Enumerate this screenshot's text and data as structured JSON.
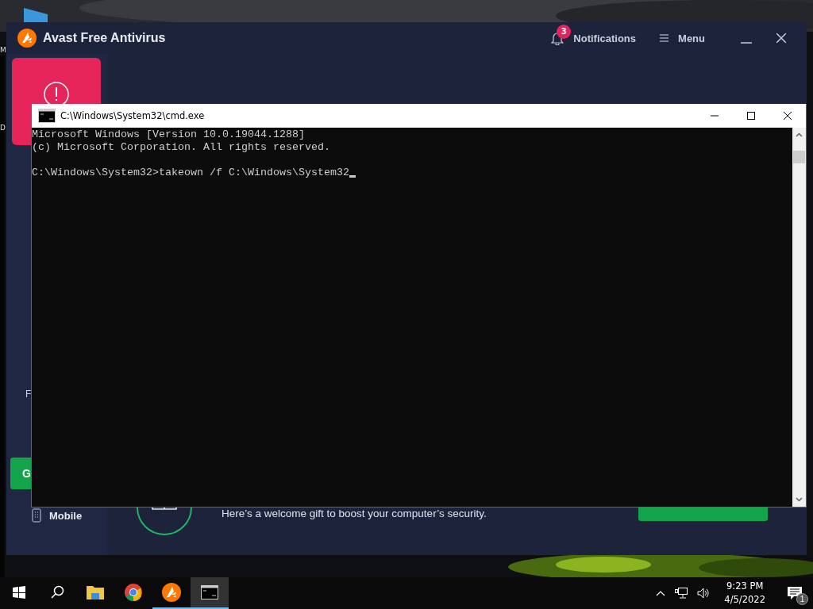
{
  "desktop": {
    "icon_labels": [
      "M",
      "D"
    ]
  },
  "avast": {
    "title": "Avast Free Antivirus",
    "notifications": {
      "label": "Notifications",
      "count": "3"
    },
    "menu": "Menu",
    "sidebar": {
      "item_fragment": "F",
      "button_fragment": "G",
      "mobile": "Mobile"
    },
    "promo_text": "Here’s a welcome gift to boost your computer’s security."
  },
  "cmd": {
    "title": "C:\\Windows\\System32\\cmd.exe",
    "paragraphs": [
      [
        "Microsoft Windows [Version 10.0.19044.1288]",
        "(c) Microsoft Corporation. All rights reserved."
      ],
      [
        "C:\\Windows\\System32>takeown /f C:\\Windows\\System32"
      ]
    ]
  },
  "taskbar": {
    "apps": [
      {
        "kind": "start",
        "running": false,
        "selected": false
      },
      {
        "kind": "search",
        "running": false,
        "selected": false
      },
      {
        "kind": "explorer",
        "running": false,
        "selected": false
      },
      {
        "kind": "chrome",
        "running": false,
        "selected": false
      },
      {
        "kind": "avast",
        "running": true,
        "selected": false
      },
      {
        "kind": "cmd",
        "running": true,
        "selected": true
      }
    ],
    "time": "9:23 PM",
    "date": "4/5/2022",
    "notification_count": "1"
  }
}
